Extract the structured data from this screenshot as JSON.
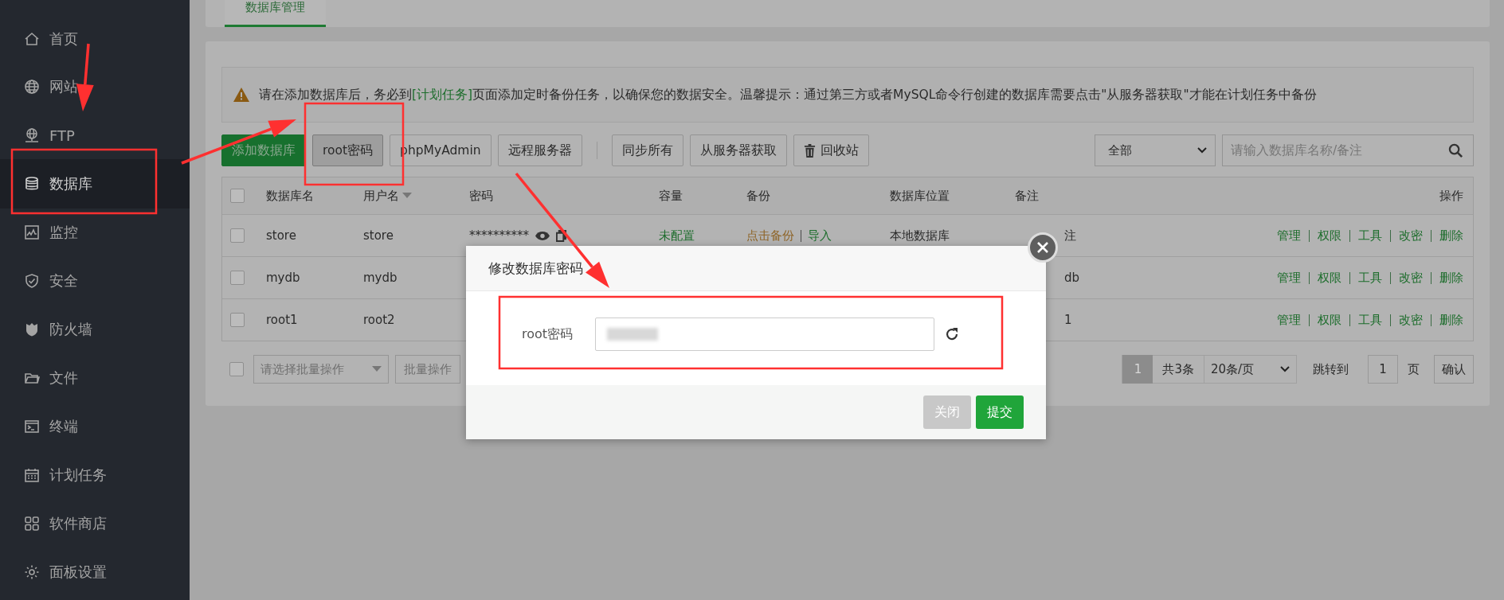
{
  "sidebar": {
    "items": [
      {
        "label": "首页",
        "selected": false
      },
      {
        "label": "网站",
        "selected": false
      },
      {
        "label": "FTP",
        "selected": false
      },
      {
        "label": "数据库",
        "selected": true
      },
      {
        "label": "监控",
        "selected": false
      },
      {
        "label": "安全",
        "selected": false
      },
      {
        "label": "防火墙",
        "selected": false
      },
      {
        "label": "文件",
        "selected": false
      },
      {
        "label": "终端",
        "selected": false
      },
      {
        "label": "计划任务",
        "selected": false
      },
      {
        "label": "软件商店",
        "selected": false
      },
      {
        "label": "面板设置",
        "selected": false
      }
    ]
  },
  "tabs": [
    {
      "label": "数据库管理",
      "selected": true
    }
  ],
  "notice": {
    "before": "请在添加数据库后，务必到",
    "link": "[计划任务]",
    "after": "页面添加定时备份任务，以确保您的数据安全。温馨提示：通过第三方或者MySQL命令行创建的数据库需要点击\"从服务器获取\"才能在计划任务中备份"
  },
  "toolbar": {
    "buttons": [
      {
        "label": "添加数据库",
        "kind": "primary"
      },
      {
        "label": "root密码",
        "kind": "pressed"
      },
      {
        "label": "phpMyAdmin",
        "kind": "default"
      },
      {
        "label": "远程服务器",
        "kind": "default"
      }
    ],
    "sync_buttons": [
      {
        "label": "同步所有",
        "kind": "default"
      },
      {
        "label": "从服务器获取",
        "kind": "default"
      },
      {
        "label": "回收站",
        "kind": "default"
      }
    ],
    "filter": {
      "value": "全部"
    },
    "search": {
      "placeholder": "请输入数据库名称/备注"
    }
  },
  "table": {
    "header_checked": false,
    "columns": [
      {
        "label": "数据库名"
      },
      {
        "label": "用户名",
        "sorted": true
      },
      {
        "label": "密码"
      },
      {
        "label": "容量"
      },
      {
        "label": "备份"
      },
      {
        "label": "数据库位置"
      },
      {
        "label": "备注"
      },
      {
        "label": "操作"
      }
    ],
    "rows": [
      {
        "checked": false,
        "name": "store",
        "user": "store",
        "password": "**********",
        "capacity": "未配置",
        "backup": [
          "点击备份",
          "导入"
        ],
        "location": "本地数据库",
        "remark": "注",
        "actions": [
          "管理",
          "权限",
          "工具",
          "改密",
          "删除"
        ]
      },
      {
        "checked": false,
        "name": "mydb",
        "user": "mydb",
        "remark": "db",
        "actions": [
          "管理",
          "权限",
          "工具",
          "改密",
          "删除"
        ]
      },
      {
        "checked": false,
        "name": "root1",
        "user": "root2",
        "remark": "1",
        "actions": [
          "管理",
          "权限",
          "工具",
          "改密",
          "删除"
        ]
      }
    ]
  },
  "pagination": {
    "select_checked": false,
    "batch_select": {
      "placeholder": "请选择批量操作"
    },
    "batch_button": "批量操作",
    "pages": [
      {
        "label": "1",
        "selected": true
      }
    ],
    "total": "共3条",
    "page_size": "20条/页",
    "jump_label": "跳转到",
    "jump_value": "1",
    "page_unit": "页",
    "confirm": "确认"
  },
  "modal": {
    "title": "修改数据库密码",
    "field_label": "root密码",
    "buttons": [
      {
        "label": "关闭",
        "kind": "secondary"
      },
      {
        "label": "提交",
        "kind": "primary"
      }
    ]
  }
}
